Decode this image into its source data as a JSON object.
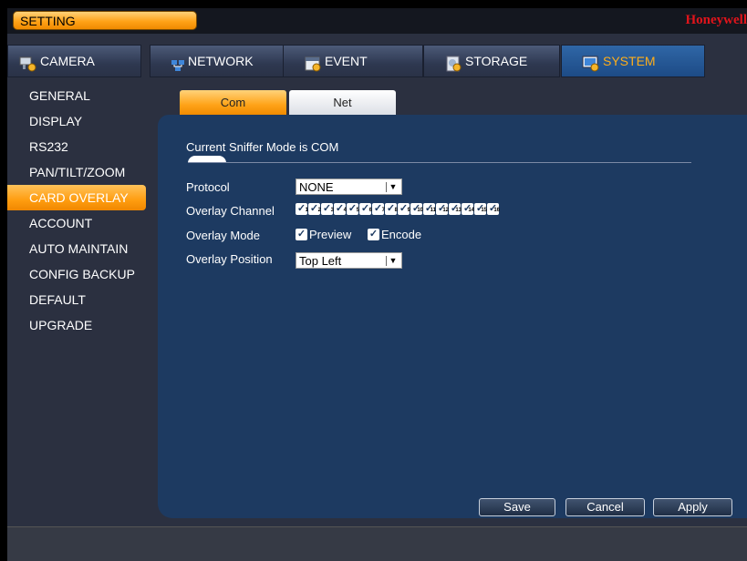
{
  "window": {
    "title": "SETTING",
    "brand": "Honeywell"
  },
  "tabs": [
    {
      "label": "CAMERA",
      "icon": "camera-gear-icon",
      "active": false
    },
    {
      "label": "NETWORK",
      "icon": "network-icon",
      "active": false
    },
    {
      "label": "EVENT",
      "icon": "event-icon",
      "active": false
    },
    {
      "label": "STORAGE",
      "icon": "storage-icon",
      "active": false
    },
    {
      "label": "SYSTEM",
      "icon": "system-gear-icon",
      "active": true
    }
  ],
  "sidebar": {
    "items": [
      {
        "label": "GENERAL"
      },
      {
        "label": "DISPLAY"
      },
      {
        "label": "RS232"
      },
      {
        "label": "PAN/TILT/ZOOM"
      },
      {
        "label": "CARD OVERLAY",
        "active": true
      },
      {
        "label": "ACCOUNT"
      },
      {
        "label": "AUTO MAINTAIN"
      },
      {
        "label": "CONFIG BACKUP"
      },
      {
        "label": "DEFAULT"
      },
      {
        "label": "UPGRADE"
      }
    ]
  },
  "subtabs": {
    "com": "Com",
    "net": "Net",
    "active": "Com"
  },
  "panel": {
    "sniffer_status": "Current Sniffer Mode is COM",
    "protocol": {
      "label": "Protocol",
      "value": "NONE"
    },
    "overlay_channel": {
      "label": "Overlay Channel",
      "channels": [
        "1",
        "2",
        "3",
        "4",
        "5",
        "6",
        "7",
        "8",
        "9",
        "10",
        "11",
        "12",
        "13",
        "14",
        "15",
        "16"
      ],
      "all_checked": true
    },
    "overlay_mode": {
      "label": "Overlay Mode",
      "preview": "Preview",
      "encode": "Encode"
    },
    "overlay_position": {
      "label": "Overlay Position",
      "value": "Top Left"
    }
  },
  "buttons": {
    "save": "Save",
    "cancel": "Cancel",
    "apply": "Apply"
  },
  "colors": {
    "accent": "#ff9d10",
    "panel": "#1d3a61",
    "brand": "#e0141b",
    "active_tab": "#1d4b86"
  }
}
